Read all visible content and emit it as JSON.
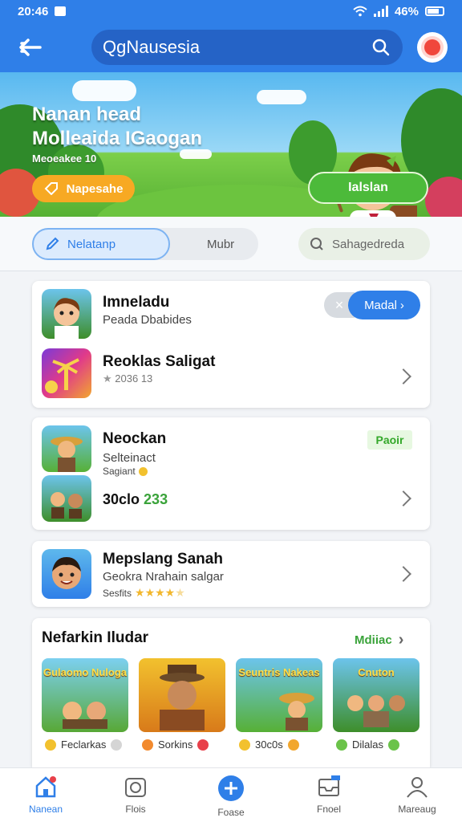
{
  "status_bar": {
    "time": "20:46",
    "battery": "46%"
  },
  "header": {
    "search_text": "QgNausesia"
  },
  "hero": {
    "title_line1": "Nanan head",
    "title_line2": "Molleaida IGaogan",
    "subtitle": "Meoeakee  10",
    "left_button": "Napesahe",
    "right_button": "Ialslan"
  },
  "tabs": {
    "active": "Nelatanp",
    "inactive": "Mubr",
    "search": "Sahagedreda"
  },
  "card1": {
    "row1": {
      "title": "Imneladu",
      "subtitle": "Peada Dbabides",
      "dismiss": "×",
      "action": "Madal"
    },
    "row2": {
      "title": "Reoklas Saligat",
      "meta": "2036   13"
    }
  },
  "card2": {
    "title": "Neockan",
    "subtitle1": "Selteinact",
    "subtitle2": "Sagiant",
    "badge": "Paoir",
    "row2_prefix": "30clo",
    "row2_value": "233"
  },
  "card3": {
    "title": "Mepslang Sanah",
    "subtitle": "Geokra Nrahain salgar",
    "rating_label": "Sesfits",
    "rating": 3.5
  },
  "section": {
    "title": "Nefarkin Iludar",
    "more": "Mdiiac",
    "games": [
      {
        "tile_text": "Gulaomo  Nuloga",
        "label": "Feclarkas",
        "dot_color": "#f2c12e",
        "end_dot": "#d5d5d5"
      },
      {
        "tile_text": "",
        "label": "Sorkins",
        "dot_color": "#f28a2e",
        "end_dot": "#e8404a"
      },
      {
        "tile_text": "Seuntris  Nakeas",
        "label": "30c0s",
        "dot_color": "#f2c12e",
        "end_dot": "#f2a72e"
      },
      {
        "tile_text": "Cnuton",
        "label": "Dilalas",
        "dot_color": "#6bc34a",
        "end_dot": "#6bc34a"
      }
    ]
  },
  "bottom_nav": [
    {
      "label": "Nanean",
      "icon": "home-icon",
      "active": true
    },
    {
      "label": "Flois",
      "icon": "camera-icon",
      "active": false
    },
    {
      "label": "Foase",
      "icon": "plus-icon",
      "active": false
    },
    {
      "label": "Fnoel",
      "icon": "inbox-icon",
      "active": false
    },
    {
      "label": "Mareaug",
      "icon": "person-icon",
      "active": false
    }
  ],
  "colors": {
    "primary": "#2f7fe8",
    "accent_green": "#4cba3a",
    "accent_orange": "#f7a923",
    "background": "#f2f4f7"
  }
}
